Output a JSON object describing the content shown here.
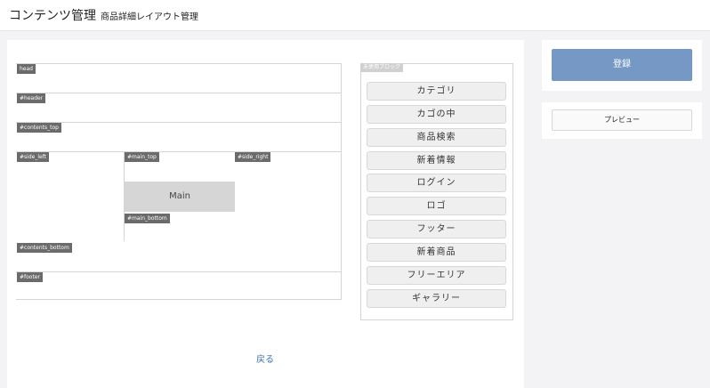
{
  "header": {
    "title": "コンテンツ管理",
    "subtitle": "商品詳細レイアウト管理"
  },
  "layout": {
    "regions": {
      "head": "head",
      "header": "#header",
      "contents_top": "#contents_top",
      "side_left": "#side_left",
      "main_top": "#main_top",
      "side_right": "#side_right",
      "main": "Main",
      "main_bottom": "#main_bottom",
      "contents_bottom": "#contents_bottom",
      "footer": "#footer"
    }
  },
  "blocks": {
    "label": "未使用ブロック",
    "items": [
      "カテゴリ",
      "カゴの中",
      "商品検索",
      "新着情報",
      "ログイン",
      "ロゴ",
      "フッター",
      "新着商品",
      "フリーエリア",
      "ギャラリー"
    ]
  },
  "actions": {
    "back": "戻る",
    "register": "登録",
    "preview": "プレビュー"
  }
}
